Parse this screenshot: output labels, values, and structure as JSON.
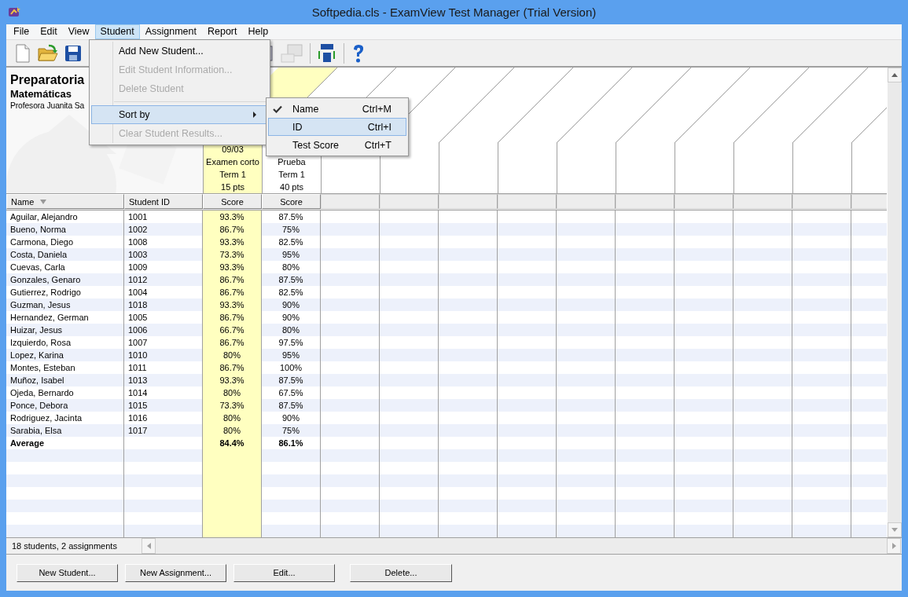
{
  "window": {
    "title": "Softpedia.cls - ExamView Test Manager (Trial Version)"
  },
  "menu_bar": [
    {
      "label": "File",
      "selected": false
    },
    {
      "label": "Edit",
      "selected": false
    },
    {
      "label": "View",
      "selected": false
    },
    {
      "label": "Student",
      "selected": true
    },
    {
      "label": "Assignment",
      "selected": false
    },
    {
      "label": "Report",
      "selected": false
    },
    {
      "label": "Help",
      "selected": false
    }
  ],
  "student_menu": [
    {
      "kind": "item",
      "label": "Add New Student...",
      "disabled": false,
      "selected": false
    },
    {
      "kind": "item",
      "label": "Edit Student Information...",
      "disabled": true,
      "selected": false
    },
    {
      "kind": "item",
      "label": "Delete Student",
      "disabled": true,
      "selected": false
    },
    {
      "kind": "separator"
    },
    {
      "kind": "submenu",
      "label": "Sort by",
      "disabled": false,
      "selected": true
    },
    {
      "kind": "item",
      "label": "Clear Student Results...",
      "disabled": true,
      "selected": false
    }
  ],
  "sort_submenu": [
    {
      "label": "Name",
      "shortcut": "Ctrl+M",
      "checked": true,
      "selected": false
    },
    {
      "label": "ID",
      "shortcut": "Ctrl+I",
      "checked": false,
      "selected": true
    },
    {
      "label": "Test Score",
      "shortcut": "Ctrl+T",
      "checked": false,
      "selected": false
    }
  ],
  "class_info": {
    "school": "Preparatoria",
    "subject": "Matemáticas",
    "teacher": "Profesora Juanita Sa"
  },
  "assignments": [
    {
      "date": "09/03",
      "name": "Examen corto",
      "term": "Term 1",
      "points": "15 pts",
      "selected": true
    },
    {
      "name": "Prueba",
      "term": "Term 1",
      "points": "40 pts",
      "selected": false
    }
  ],
  "columns": [
    "Name",
    "Student ID",
    "Score",
    "Score"
  ],
  "rows": [
    {
      "name": "Aguilar, Alejandro",
      "id": "1001",
      "scores": [
        "93.3%",
        "87.5%"
      ]
    },
    {
      "name": "Bueno, Norma",
      "id": "1002",
      "scores": [
        "86.7%",
        "75%"
      ]
    },
    {
      "name": "Carmona, Diego",
      "id": "1008",
      "scores": [
        "93.3%",
        "82.5%"
      ]
    },
    {
      "name": "Costa, Daniela",
      "id": "1003",
      "scores": [
        "73.3%",
        "95%"
      ]
    },
    {
      "name": "Cuevas, Carla",
      "id": "1009",
      "scores": [
        "93.3%",
        "80%"
      ]
    },
    {
      "name": "Gonzales, Genaro",
      "id": "1012",
      "scores": [
        "86.7%",
        "87.5%"
      ]
    },
    {
      "name": "Gutierrez, Rodrigo",
      "id": "1004",
      "scores": [
        "86.7%",
        "82.5%"
      ]
    },
    {
      "name": "Guzman, Jesus",
      "id": "1018",
      "scores": [
        "93.3%",
        "90%"
      ]
    },
    {
      "name": "Hernandez, German",
      "id": "1005",
      "scores": [
        "86.7%",
        "90%"
      ]
    },
    {
      "name": "Huizar, Jesus",
      "id": "1006",
      "scores": [
        "66.7%",
        "80%"
      ]
    },
    {
      "name": "Izquierdo, Rosa",
      "id": "1007",
      "scores": [
        "86.7%",
        "97.5%"
      ]
    },
    {
      "name": "Lopez, Karina",
      "id": "1010",
      "scores": [
        "80%",
        "95%"
      ]
    },
    {
      "name": "Montes, Esteban",
      "id": "1011",
      "scores": [
        "86.7%",
        "100%"
      ]
    },
    {
      "name": "Muñoz, Isabel",
      "id": "1013",
      "scores": [
        "93.3%",
        "87.5%"
      ]
    },
    {
      "name": "Ojeda, Bernardo",
      "id": "1014",
      "scores": [
        "80%",
        "67.5%"
      ]
    },
    {
      "name": "Ponce, Debora",
      "id": "1015",
      "scores": [
        "73.3%",
        "87.5%"
      ]
    },
    {
      "name": "Rodriguez, Jacinta",
      "id": "1016",
      "scores": [
        "80%",
        "90%"
      ]
    },
    {
      "name": "Sarabia, Elsa",
      "id": "1017",
      "scores": [
        "80%",
        "75%"
      ]
    }
  ],
  "average": {
    "label": "Average",
    "scores": [
      "84.4%",
      "86.1%"
    ]
  },
  "status_bar": "18 students, 2 assignments",
  "buttons": [
    "New Student...",
    "New Assignment...",
    "Edit...",
    "Delete..."
  ]
}
